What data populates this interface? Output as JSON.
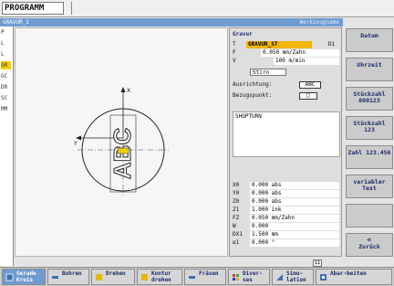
{
  "header": {
    "app_name": "PROGRAMM"
  },
  "status": {
    "left": "GRAVUR_2",
    "right": "Werkzeugname"
  },
  "tool_list": [
    "P",
    "L",
    "L",
    "GR",
    "GC",
    "DR",
    "SC",
    "MM"
  ],
  "panel": {
    "title": "Gravur",
    "rows": {
      "t_label": "T",
      "t_value": "GRAVUR_ST",
      "t_d": "D1",
      "f_label": "F",
      "f_value": "0.050 mm/Zahn",
      "v_label": "V",
      "v_value": "100 m/min",
      "face_value": "Stirn",
      "align_label": "Ausrichtung:",
      "align_value": "ABC",
      "ref_label": "Bezugspunkt:",
      "ref_value": "□",
      "text_label": "SHOPTURN",
      "x0_label": "X0",
      "x0_value": "0.000 abs",
      "y0_label": "Y0",
      "y0_value": "0.000 abs",
      "z0_label": "Z0",
      "z0_value": "0.000 abs",
      "z1_label": "Z1",
      "z1_value": "1.000 ink",
      "fz_label": "FZ",
      "fz_value": "0.050 mm/Zahn",
      "w_label": "W",
      "w_value": "0.000",
      "dx1_label": "DX1",
      "dx1_value": "1.500 mm",
      "a1_label": "α1",
      "a1_value": "0.000 °"
    }
  },
  "graphic": {
    "axis_x": "X",
    "axis_y": "Y",
    "engrave_text": "ABC"
  },
  "softkeys_right": [
    "Datum",
    "Uhrzeit",
    "Stückzahl 000123",
    "Stückzahl 123",
    "Zahl 123.456",
    "variabler Text",
    "",
    "Zurück"
  ],
  "softkeys_bottom": [
    "Gerade Kreis",
    "Bohren",
    "Drehen",
    "Kontur drehen",
    "Fräsen",
    "Diver-ses",
    "Simu-lation",
    "Abar-beiten"
  ],
  "colors": {
    "accent": "#6f9bd1",
    "highlight": "#f2b600",
    "softkey_text": "#1a2a6a"
  }
}
